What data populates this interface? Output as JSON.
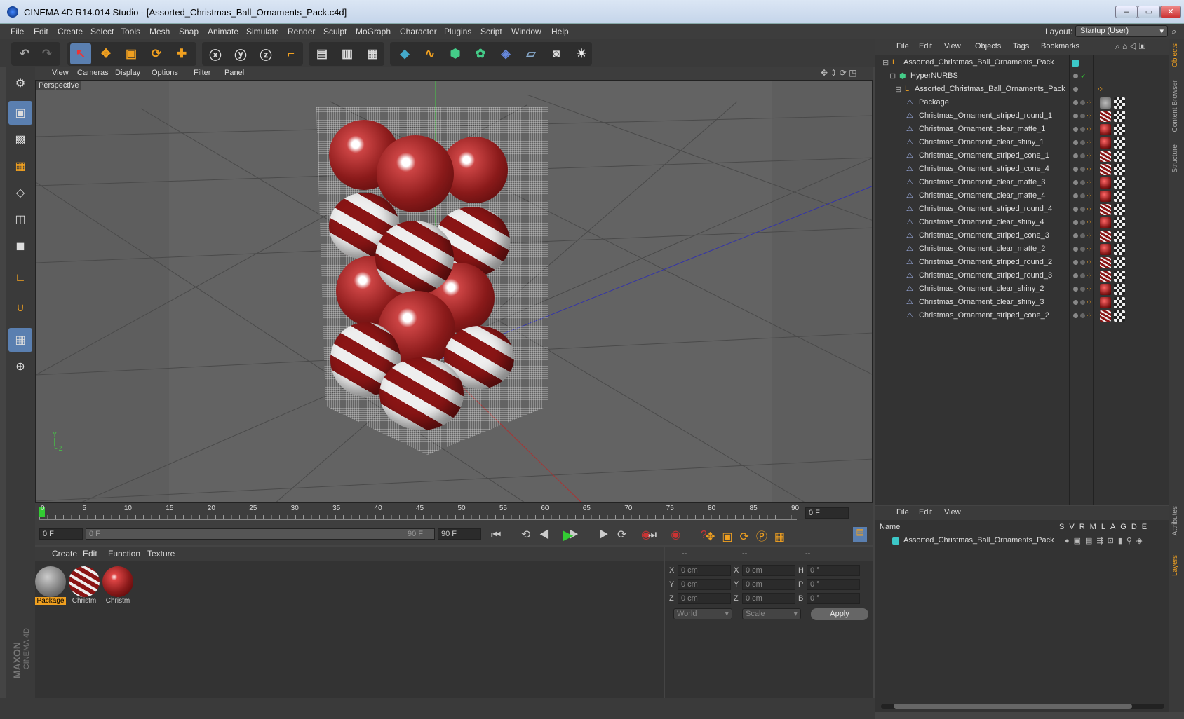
{
  "window": {
    "title": "CINEMA 4D R14.014 Studio - [Assorted_Christmas_Ball_Ornaments_Pack.c4d]"
  },
  "menu": [
    "File",
    "Edit",
    "Create",
    "Select",
    "Tools",
    "Mesh",
    "Snap",
    "Animate",
    "Simulate",
    "Render",
    "Sculpt",
    "MoGraph",
    "Character",
    "Plugins",
    "Script",
    "Window",
    "Help"
  ],
  "layout": {
    "label": "Layout:",
    "value": "Startup (User)"
  },
  "viewport": {
    "menu": [
      "View",
      "Cameras",
      "Display",
      "Options",
      "Filter",
      "Panel"
    ],
    "name": "Perspective"
  },
  "timeline": {
    "ticks": [
      "0",
      "5",
      "10",
      "15",
      "20",
      "25",
      "30",
      "35",
      "40",
      "45",
      "50",
      "55",
      "60",
      "65",
      "70",
      "75",
      "80",
      "85",
      "90"
    ],
    "frame_field": "0 F"
  },
  "transport": {
    "start": "0 F",
    "range_start": "0 F",
    "range_end": "90 F",
    "end": "90 F"
  },
  "materials": {
    "menu": [
      "Create",
      "Edit",
      "Function",
      "Texture"
    ],
    "items": [
      {
        "label": "Package"
      },
      {
        "label": "Christm"
      },
      {
        "label": "Christm"
      }
    ]
  },
  "coords": {
    "headers": [
      "--",
      "--",
      "--"
    ],
    "rows": [
      {
        "a": "X",
        "av": "0 cm",
        "b": "X",
        "bv": "0 cm",
        "c": "H",
        "cv": "0 °"
      },
      {
        "a": "Y",
        "av": "0 cm",
        "b": "Y",
        "bv": "0 cm",
        "c": "P",
        "cv": "0 °"
      },
      {
        "a": "Z",
        "av": "0 cm",
        "b": "Z",
        "bv": "0 cm",
        "c": "B",
        "cv": "0 °"
      }
    ],
    "mode1": "World",
    "mode2": "Scale",
    "apply": "Apply"
  },
  "objects": {
    "menu": [
      "File",
      "Edit",
      "View",
      "Objects",
      "Tags",
      "Bookmarks"
    ],
    "root": "Assorted_Christmas_Ball_Ornaments_Pack",
    "nurbs": "HyperNURBS",
    "group": "Assorted_Christmas_Ball_Ornaments_Pack",
    "items": [
      {
        "name": "Package",
        "mat": "package"
      },
      {
        "name": "Christmas_Ornament_striped_round_1",
        "mat": "striped"
      },
      {
        "name": "Christmas_Ornament_clear_matte_1",
        "mat": "red"
      },
      {
        "name": "Christmas_Ornament_clear_shiny_1",
        "mat": "red"
      },
      {
        "name": "Christmas_Ornament_striped_cone_1",
        "mat": "striped"
      },
      {
        "name": "Christmas_Ornament_striped_cone_4",
        "mat": "striped"
      },
      {
        "name": "Christmas_Ornament_clear_matte_3",
        "mat": "red"
      },
      {
        "name": "Christmas_Ornament_clear_matte_4",
        "mat": "red"
      },
      {
        "name": "Christmas_Ornament_striped_round_4",
        "mat": "striped"
      },
      {
        "name": "Christmas_Ornament_clear_shiny_4",
        "mat": "red"
      },
      {
        "name": "Christmas_Ornament_striped_cone_3",
        "mat": "striped"
      },
      {
        "name": "Christmas_Ornament_clear_matte_2",
        "mat": "red"
      },
      {
        "name": "Christmas_Ornament_striped_round_2",
        "mat": "striped"
      },
      {
        "name": "Christmas_Ornament_striped_round_3",
        "mat": "striped"
      },
      {
        "name": "Christmas_Ornament_clear_shiny_2",
        "mat": "red"
      },
      {
        "name": "Christmas_Ornament_clear_shiny_3",
        "mat": "red"
      },
      {
        "name": "Christmas_Ornament_striped_cone_2",
        "mat": "striped"
      }
    ]
  },
  "layers": {
    "menu": [
      "File",
      "Edit",
      "View"
    ],
    "name_header": "Name",
    "cols": [
      "S",
      "V",
      "R",
      "M",
      "L",
      "A",
      "G",
      "D",
      "E"
    ],
    "row": "Assorted_Christmas_Ball_Ornaments_Pack"
  },
  "right_tabs": [
    "Objects",
    "Content Browser",
    "Structure"
  ],
  "right_tabs2": [
    "Attributes",
    "Layers"
  ],
  "brand": [
    "MAXON",
    "CINEMA 4D"
  ],
  "colors": {
    "accent": "#f0a020",
    "selected": "#5a7fb0",
    "layer": "#3cc8c8"
  }
}
